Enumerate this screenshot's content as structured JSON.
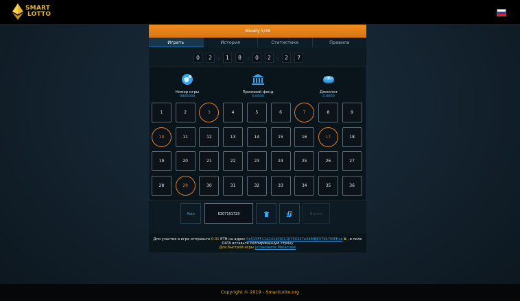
{
  "brand": {
    "logo_line1": "SMART",
    "logo_line2": "LOTTO"
  },
  "lottery": {
    "title": "Weekly 5/36"
  },
  "tabs": [
    {
      "label": "Играть",
      "active": true
    },
    {
      "label": "История",
      "active": false
    },
    {
      "label": "Статистика",
      "active": false
    },
    {
      "label": "Правила",
      "active": false
    }
  ],
  "timer": {
    "digits": [
      "0",
      "2",
      "1",
      "8",
      "0",
      "2",
      "2",
      "7"
    ],
    "separator": ":"
  },
  "stats": [
    {
      "icon": "globe-coin-icon",
      "label": "Номер игры",
      "value": "0000000"
    },
    {
      "icon": "bank-icon",
      "label": "Призовой фонд",
      "value": "0.0000"
    },
    {
      "icon": "money-stack-icon",
      "label": "Джекпот",
      "value": "0.0000"
    }
  ],
  "numbers": [
    "1",
    "2",
    "3",
    "4",
    "5",
    "6",
    "7",
    "8",
    "9",
    "10",
    "11",
    "12",
    "13",
    "14",
    "15",
    "16",
    "17",
    "18",
    "19",
    "20",
    "21",
    "22",
    "23",
    "24",
    "25",
    "26",
    "27",
    "28",
    "29",
    "30",
    "31",
    "32",
    "33",
    "34",
    "35",
    "36"
  ],
  "selected_numbers": [
    "3",
    "7",
    "10",
    "17",
    "29"
  ],
  "controls": {
    "auto_label": "Auto",
    "combination": "0307101729",
    "trash_icon": "trash-icon",
    "copy_icon": "copy-icon",
    "play_label": "Играть"
  },
  "info": {
    "part1": "Для участия в игре отправьте",
    "amount": "0.01",
    "part2": "ETH на адрес",
    "address": "0x525FF11A2416f10116750247e348fBE37947f9EF.ce",
    "part3": ", в поле DATA вставьте скопированную строку",
    "fast_prefix": "Для быстрой игры",
    "metamask_link": "установите Metamask"
  },
  "footer": {
    "text": "Copyright © 2019 -",
    "site": "SmartLotto.org"
  },
  "colors": {
    "accent": "#f08c1e",
    "link": "#3aa3e8",
    "gold": "#e7b52d",
    "selected": "#e0802a"
  }
}
